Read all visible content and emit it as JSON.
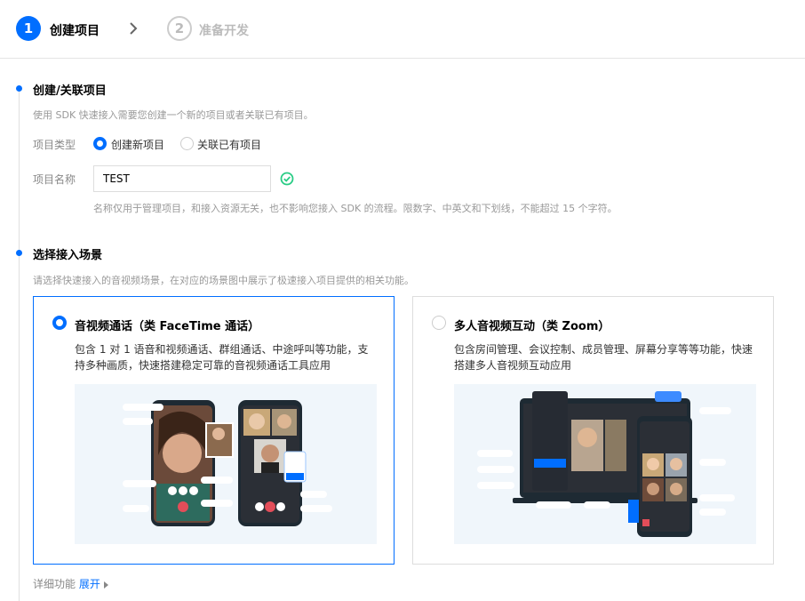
{
  "steps": [
    {
      "number": "1",
      "label": "创建项目"
    },
    {
      "number": "2",
      "label": "准备开发"
    }
  ],
  "section1": {
    "title": "创建/关联项目",
    "description": "使用 SDK 快速接入需要您创建一个新的项目或者关联已有项目。",
    "project_type_label": "项目类型",
    "options": [
      "创建新项目",
      "关联已有项目"
    ],
    "selected_option": "创建新项目",
    "project_name_label": "项目名称",
    "project_name_value": "TEST",
    "project_name_hint": "名称仅用于管理项目，和接入资源无关，也不影响您接入 SDK 的流程。限数字、中英文和下划线，不能超过 15 个字符。"
  },
  "section2": {
    "title": "选择接入场景",
    "description": "请选择快速接入的音视频场景，在对应的场景图中展示了极速接入项目提供的相关功能。",
    "cards": [
      {
        "title": "音视频通话（类 FaceTime 通话）",
        "description": "包含 1 对 1 语音和视频通话、群组通话、中途呼叫等功能，支持多种画质，快速搭建稳定可靠的音视频通话工具应用",
        "selected": true
      },
      {
        "title": "多人音视频互动（类 Zoom）",
        "description": "包含房间管理、会议控制、成员管理、屏幕分享等等功能，快速搭建多人音视频互动应用",
        "selected": false
      }
    ]
  },
  "footer": {
    "detail_label": "详细功能",
    "expand_link": "展开"
  },
  "colors": {
    "accent": "#006eff",
    "success": "#29cc85"
  }
}
